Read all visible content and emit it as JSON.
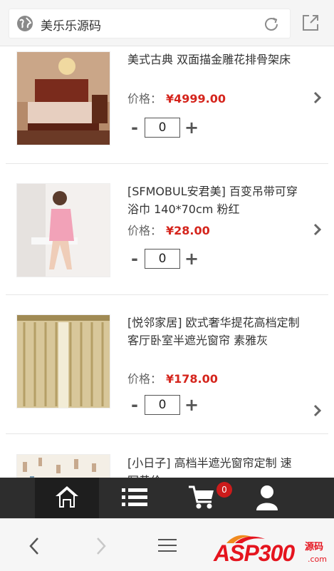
{
  "browser": {
    "address_title": "美乐乐源码"
  },
  "products": [
    {
      "title": "美式古典 双面描金雕花排骨架床",
      "price_label": "价格：",
      "price": "¥4999.00",
      "qty": "0"
    },
    {
      "title": "[SFMOBUL安君美] 百变吊带可穿浴巾 140*70cm 粉红",
      "price_label": "价格：",
      "price": "¥28.00",
      "qty": "0"
    },
    {
      "title": "[悦邻家居] 欧式奢华提花高档定制客厅卧室半遮光窗帘 素雅灰",
      "price_label": "价格：",
      "price": "¥178.00",
      "qty": "0"
    },
    {
      "title": "[小日子] 高档半遮光窗帘定制 速写黄价"
    }
  ],
  "qty_controls": {
    "minus": "-",
    "plus": "+"
  },
  "app_nav": {
    "cart_badge": "0",
    "items": [
      "home-icon",
      "list-icon",
      "cart-icon",
      "user-icon"
    ]
  },
  "watermark": {
    "main": "ASP300",
    "sub1": "源码",
    "sub2": ".com"
  }
}
